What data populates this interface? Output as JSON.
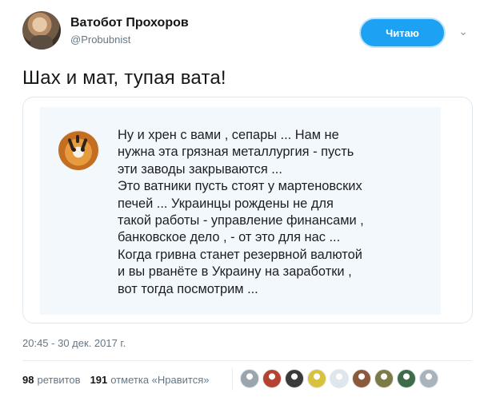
{
  "author": {
    "name": "Ватобот Прохоров",
    "handle": "@Probubnist"
  },
  "follow_button": {
    "label": "Читаю"
  },
  "tweet": {
    "text": "Шах и мат, тупая вата!",
    "timestamp": "20:45 - 30 дек. 2017 г."
  },
  "media": {
    "quote_lines": [
      "Ну  и хрен с вами , сепары ...  Нам не",
      "нужна эта грязная  металлургия - пусть",
      "эти заводы закрываются ...",
      "Это ватники пусть стоят у мартеновских",
      "печей ...  Украинцы рождены не для",
      "такой работы -   управление финансами  ,",
      "банковское дело , - от это для нас ...",
      "Когда гривна станет резервной валютой",
      "и вы рванёте в Украину на заработки ,",
      "вот тогда посмотрим ..."
    ]
  },
  "stats": {
    "retweets_count": "98",
    "retweets_label": "ретвитов",
    "likes_count": "191",
    "likes_label": "отметка «Нравится»"
  },
  "likers": [
    {
      "icon": "avatar-gray",
      "color": "#9aa5ae"
    },
    {
      "icon": "avatar-red",
      "color": "#b5432f"
    },
    {
      "icon": "avatar-dark",
      "color": "#3a3a3a"
    },
    {
      "icon": "avatar-yellow",
      "color": "#d9c23b"
    },
    {
      "icon": "avatar-light",
      "color": "#dfe7ee"
    },
    {
      "icon": "avatar-brown",
      "color": "#8a5a3a"
    },
    {
      "icon": "avatar-olive",
      "color": "#7c7a45"
    },
    {
      "icon": "avatar-green",
      "color": "#3f6b4a"
    },
    {
      "icon": "avatar-gray2",
      "color": "#a8b3bc"
    }
  ]
}
